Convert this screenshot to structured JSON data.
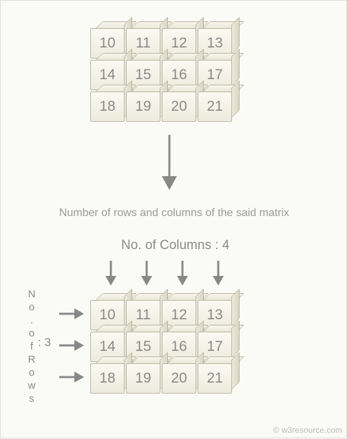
{
  "matrix_top": {
    "rows": [
      [
        "10",
        "11",
        "12",
        "13"
      ],
      [
        "14",
        "15",
        "16",
        "17"
      ],
      [
        "18",
        "19",
        "20",
        "21"
      ]
    ]
  },
  "caption": "Number of rows and columns of the said matrix",
  "cols_label": "No. of Columns : 4",
  "rows_label_letters": [
    "N",
    "o",
    ".",
    "o",
    "f",
    " ",
    "R",
    "o",
    "w",
    "s"
  ],
  "rows_count": ": 3",
  "matrix_bottom": {
    "rows": [
      [
        "10",
        "11",
        "12",
        "13"
      ],
      [
        "14",
        "15",
        "16",
        "17"
      ],
      [
        "18",
        "19",
        "20",
        "21"
      ]
    ]
  },
  "copyright": "© w3resource.com",
  "chart_data": {
    "type": "table",
    "title": "Number of rows and columns of the said matrix",
    "rows": 3,
    "columns": 4,
    "values": [
      [
        10,
        11,
        12,
        13
      ],
      [
        14,
        15,
        16,
        17
      ],
      [
        18,
        19,
        20,
        21
      ]
    ]
  }
}
